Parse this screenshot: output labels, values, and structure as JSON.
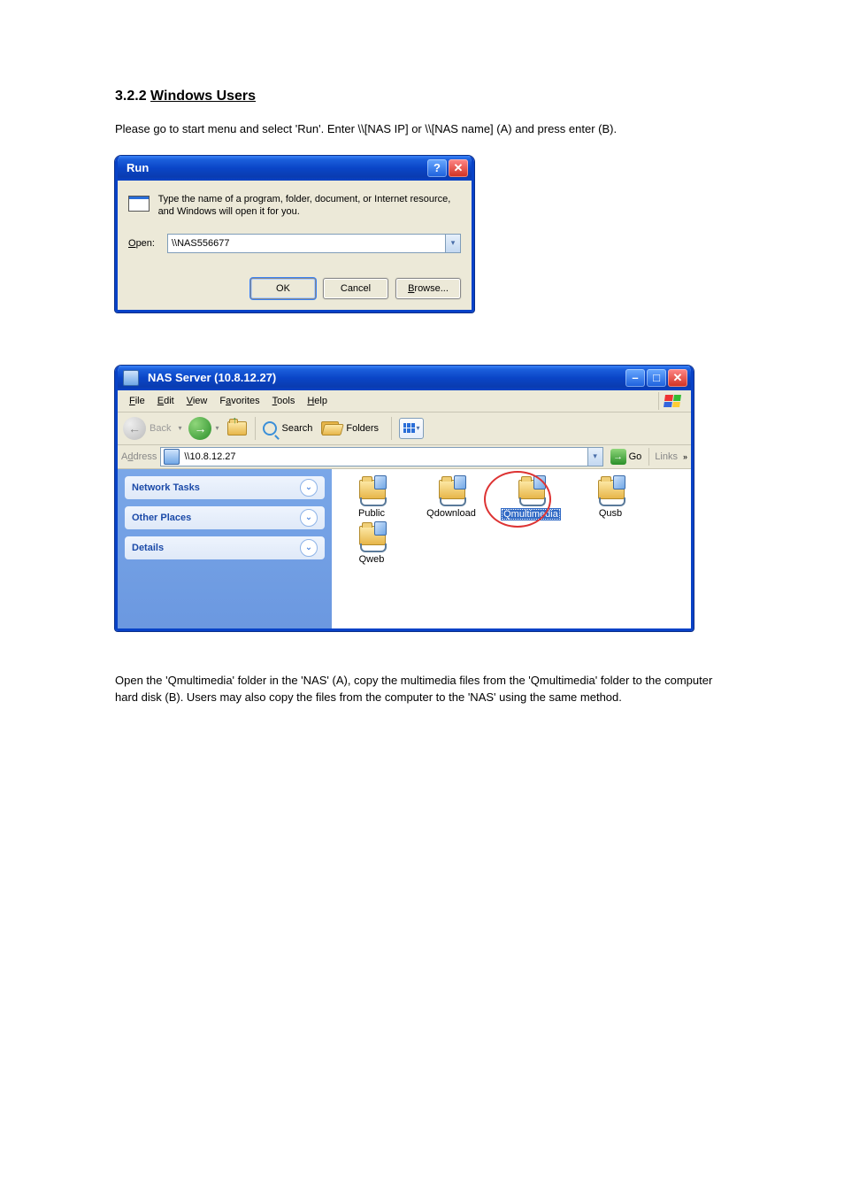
{
  "doc": {
    "heading_prefix": "3.2.2",
    "heading_text": "Windows Users",
    "para": "Please go to start menu and select 'Run'. Enter \\\\[NAS IP] or \\\\[NAS name] (A) and press enter (B).",
    "para2": "Open the 'Qmultimedia' folder in the 'NAS' (A), copy the multimedia files from the 'Qmultimedia' folder to the computer hard disk (B). Users may also copy the files from the computer to the 'NAS' using the same method."
  },
  "run": {
    "title": "Run",
    "desc": "Type the name of a program, folder, document, or Internet resource, and Windows will open it for you.",
    "open_label": "Open:",
    "input_value": "\\\\NAS556677",
    "ok": "OK",
    "cancel": "Cancel",
    "browse": "Browse..."
  },
  "explorer": {
    "title": "NAS Server (10.8.12.27)",
    "menu": {
      "file": "File",
      "edit": "Edit",
      "view": "View",
      "favorites": "Favorites",
      "tools": "Tools",
      "help": "Help"
    },
    "back": "Back",
    "search": "Search",
    "folders": "Folders",
    "address_label": "Address",
    "address_value": "\\\\10.8.12.27",
    "go": "Go",
    "links": "Links",
    "side": {
      "network": "Network Tasks",
      "other": "Other Places",
      "details": "Details"
    },
    "items": [
      {
        "label": "Public"
      },
      {
        "label": "Qdownload"
      },
      {
        "label": "Qmultimedia",
        "selected": true
      },
      {
        "label": "Qusb"
      },
      {
        "label": "Qweb"
      }
    ]
  }
}
